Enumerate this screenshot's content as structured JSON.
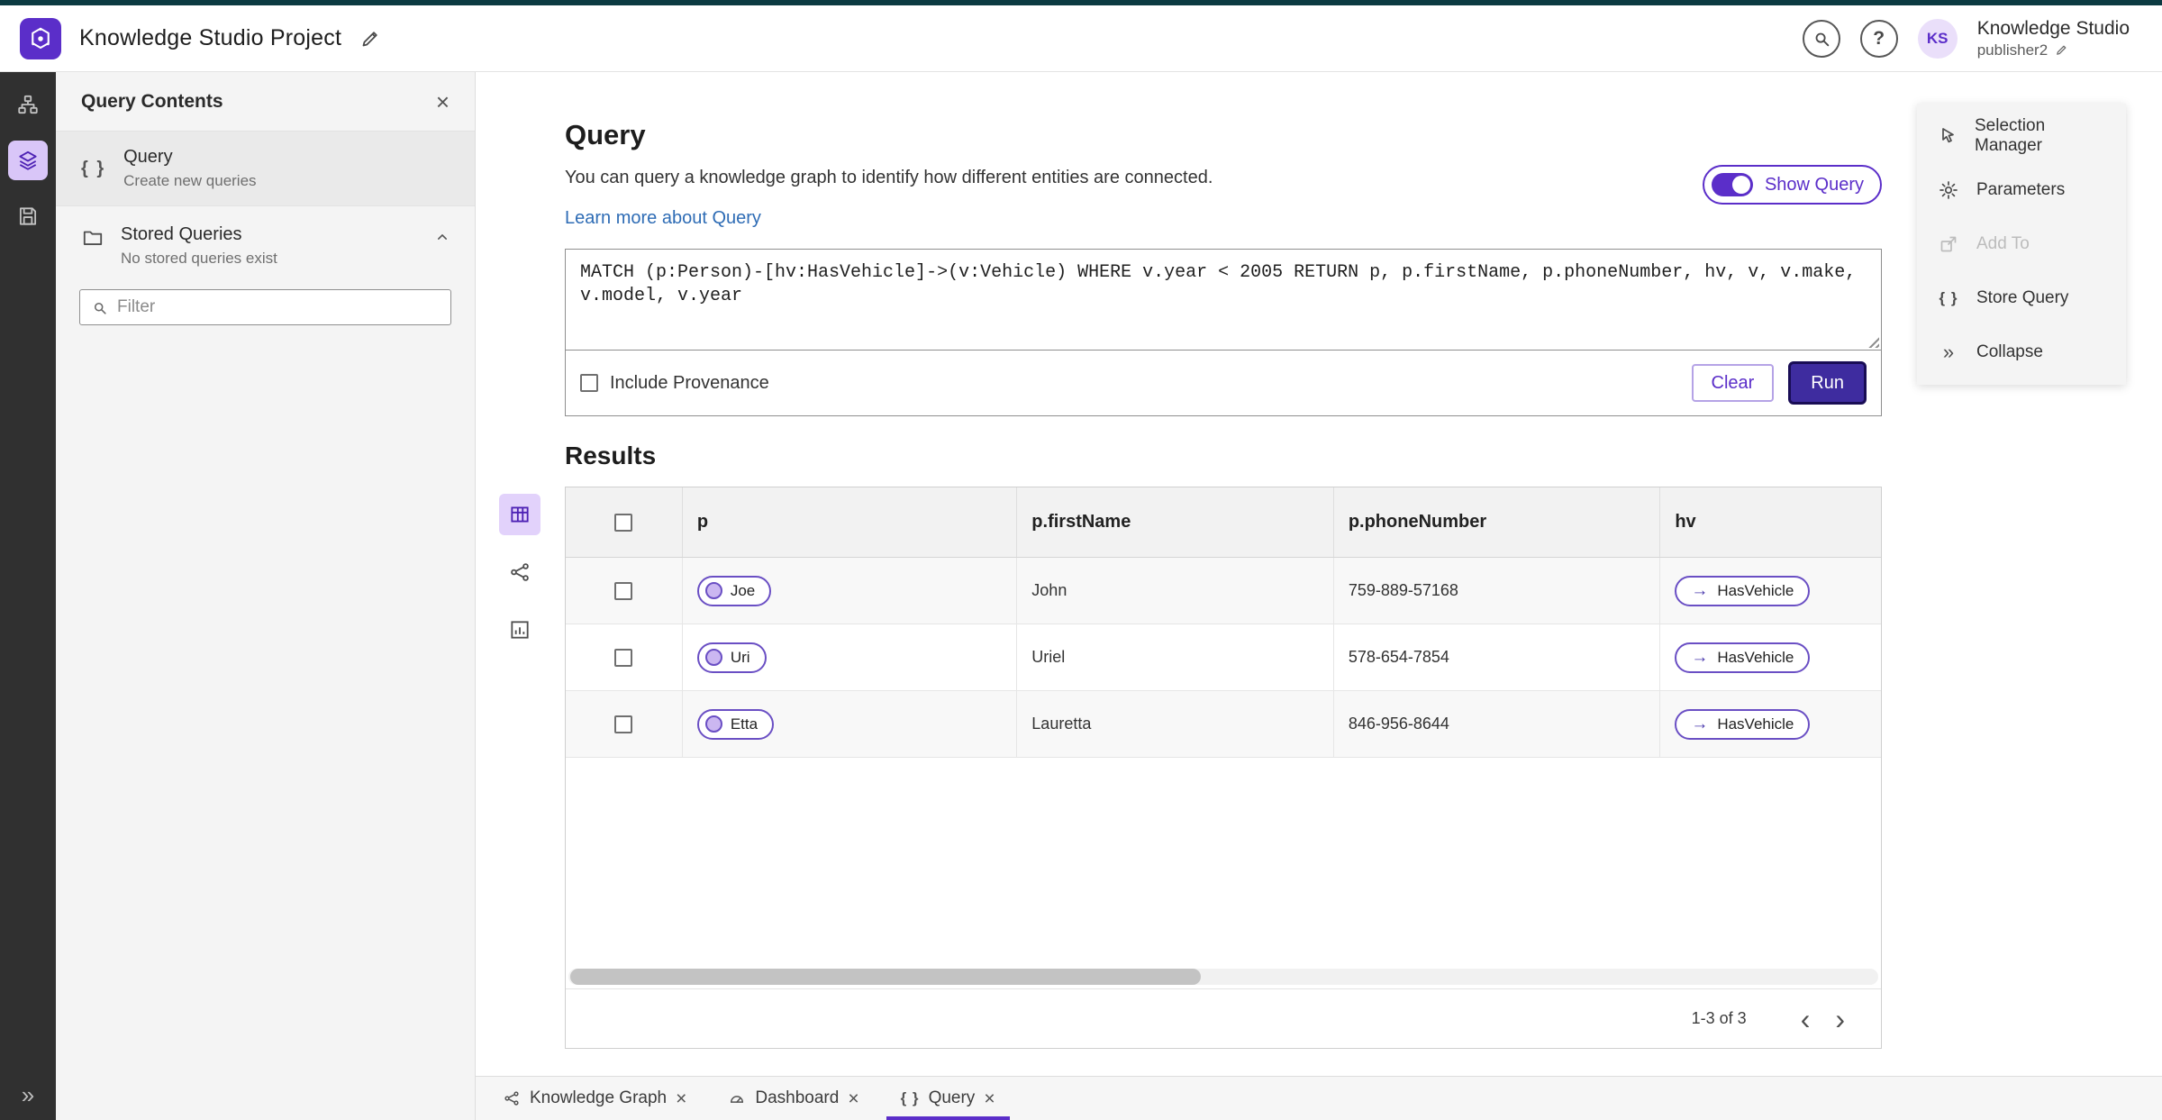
{
  "topbar": {
    "title": "Knowledge Studio Project",
    "user": {
      "initials": "KS",
      "name": "Knowledge Studio",
      "role": "publisher2"
    }
  },
  "left_panel": {
    "title": "Query Contents",
    "query_item": {
      "title": "Query",
      "subtitle": "Create new queries"
    },
    "stored_queries": {
      "title": "Stored Queries",
      "subtitle": "No stored queries exist"
    },
    "filter_placeholder": "Filter"
  },
  "query_section": {
    "title": "Query",
    "description": "You can query a knowledge graph to identify how different entities are connected.",
    "learn_more": "Learn more about Query",
    "show_query": "Show Query",
    "query_text": "MATCH (p:Person)-[hv:HasVehicle]->(v:Vehicle) WHERE v.year < 2005 RETURN p, p.firstName, p.phoneNumber, hv, v, v.make, v.model, v.year",
    "include_provenance": "Include Provenance",
    "clear_button": "Clear",
    "run_button": "Run"
  },
  "results": {
    "title": "Results",
    "columns": [
      "p",
      "p.firstName",
      "p.phoneNumber",
      "hv"
    ],
    "rows": [
      {
        "p": "Joe",
        "firstName": "John",
        "phoneNumber": "759-889-57168",
        "hv": "HasVehicle"
      },
      {
        "p": "Uri",
        "firstName": "Uriel",
        "phoneNumber": "578-654-7854",
        "hv": "HasVehicle"
      },
      {
        "p": "Etta",
        "firstName": "Lauretta",
        "phoneNumber": "846-956-8644",
        "hv": "HasVehicle"
      }
    ],
    "pagination": "1-3 of 3"
  },
  "right_menu": {
    "items": [
      "Selection Manager",
      "Parameters",
      "Add To",
      "Store Query",
      "Collapse"
    ]
  },
  "bottom_tabs": [
    {
      "label": "Knowledge Graph"
    },
    {
      "label": "Dashboard"
    },
    {
      "label": "Query"
    }
  ],
  "icons": {
    "help": "?",
    "collapse": "»",
    "braces": "{ }",
    "arrow_right": "→",
    "chevron_left": "‹",
    "chevron_right": "›",
    "close": "×"
  },
  "colors": {
    "accent": "#5b2ec9",
    "run_button": "#3e2c9f",
    "link": "#2e6cb5",
    "top_strip": "#0b3a41"
  }
}
